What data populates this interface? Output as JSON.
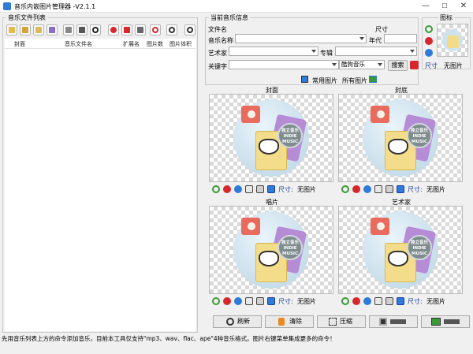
{
  "window": {
    "title": "音乐内嵌图片管理器  -V2.1.1",
    "min": "—",
    "max": "☐",
    "close": "✕"
  },
  "left": {
    "group_title": "音乐文件列表",
    "columns": [
      "封面",
      "音乐文件名",
      "扩展名",
      "图片数",
      "图片体积"
    ]
  },
  "info": {
    "group_title": "当前音乐信息",
    "file_label": "文件名",
    "size_label": "尺寸",
    "name_label": "音乐名称",
    "year_label": "年代",
    "artist_label": "艺术家",
    "album_label": "专辑",
    "keyword_label": "关键字",
    "keyword_select": "酷狗音乐",
    "search_btn": "搜索",
    "common_images": "常用图片",
    "all_images": "所有图片"
  },
  "icon_panel": {
    "title": "图标",
    "size_label": "尺寸",
    "no_image": "无图片"
  },
  "panels": [
    {
      "title": "封面",
      "size_label": "尺寸:",
      "value": "无图片"
    },
    {
      "title": "封底",
      "size_label": "尺寸:",
      "value": "无图片"
    },
    {
      "title": "唱片",
      "size_label": "尺寸:",
      "value": "无图片"
    },
    {
      "title": "艺术家",
      "size_label": "尺寸:",
      "value": "无图片"
    }
  ],
  "placeholder_badge": {
    "line1": "INDIE",
    "line2": "MUSIC",
    "top": "独立音乐"
  },
  "bottom": {
    "refresh": "刷新",
    "clear": "清除",
    "compress": "压缩",
    "save_all": "",
    "export": ""
  },
  "status": "先用音乐列表上方的命令添加音乐，目前本工具仅支持\"mp3、wav、flac、ape\"4种音乐格式。图片右键菜单集成更多的命令！",
  "colors": {
    "accent": "#2f7bd9",
    "red": "#d6272c",
    "green": "#3a9a3a",
    "orange": "#e88a20"
  }
}
